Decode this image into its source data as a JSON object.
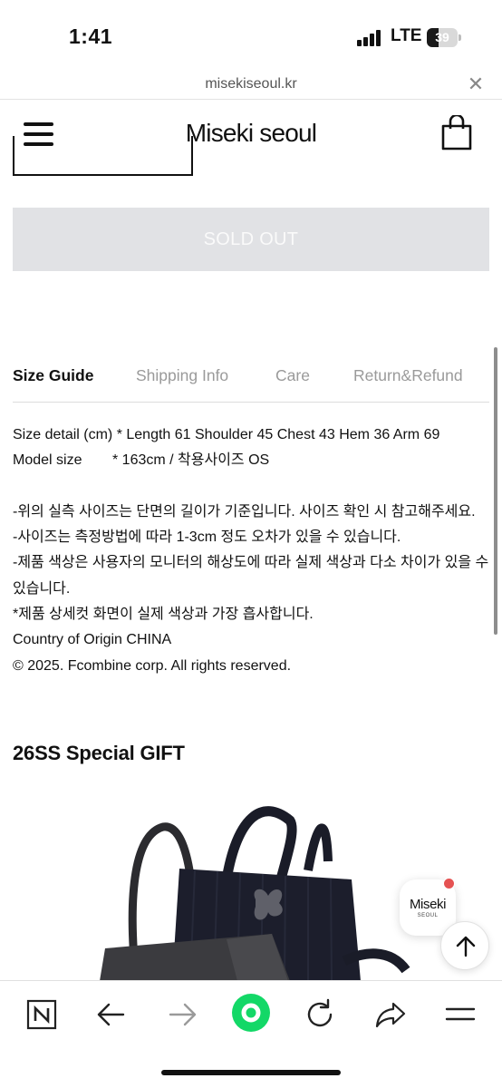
{
  "status_bar": {
    "time": "1:41",
    "network": "LTE",
    "battery": "39",
    "battery_level_percent": 39
  },
  "browser": {
    "url": "misekiseoul.kr",
    "close_icon": "close-icon"
  },
  "header": {
    "brand": "Miseki seoul",
    "menu_icon": "hamburger-menu-icon",
    "cart_icon": "shopping-bag-icon"
  },
  "product": {
    "sold_out_label": "SOLD OUT"
  },
  "tabs": [
    {
      "label": "Size Guide",
      "active": true
    },
    {
      "label": "Shipping Info",
      "active": false
    },
    {
      "label": "Care",
      "active": false
    },
    {
      "label": "Return&Refund",
      "active": false
    }
  ],
  "size_guide": {
    "detail": "Size detail (cm) * Length 61 Shoulder 45 Chest 43 Hem 36 Arm 69",
    "model_label": "Model size",
    "model_value": "* 163cm / 착용사이즈 OS",
    "notes": [
      "-위의 실측 사이즈는 단면의 길이가 기준입니다. 사이즈 확인 시 참고해주세요.",
      "-사이즈는 측정방법에 따라 1-3cm 정도 오차가 있을 수 있습니다.",
      "-제품 색상은 사용자의 모니터의 해상도에 따라 실제 색상과 다소 차이가 있을 수 있습니다.",
      "*제품 상세컷 화면이 실제 색상과 가장 흡사합니다."
    ],
    "origin": "Country of Origin CHINA",
    "copyright": "© 2025. Fcombine corp. All rights reserved."
  },
  "gift": {
    "title": "26SS Special GIFT"
  },
  "floating": {
    "logo_main": "Miseki",
    "logo_sub": "SEOUL",
    "scroll_top_icon": "arrow-up-icon"
  },
  "toolbar": {
    "items": [
      "naver-n-icon",
      "back-arrow-icon",
      "forward-arrow-icon",
      "green-dot-icon",
      "reload-icon",
      "share-icon",
      "menu-lines-icon"
    ]
  },
  "colors": {
    "sold_out_bg": "#e1e2e5",
    "accent_green": "#13d867",
    "badge_red": "#e55252"
  }
}
